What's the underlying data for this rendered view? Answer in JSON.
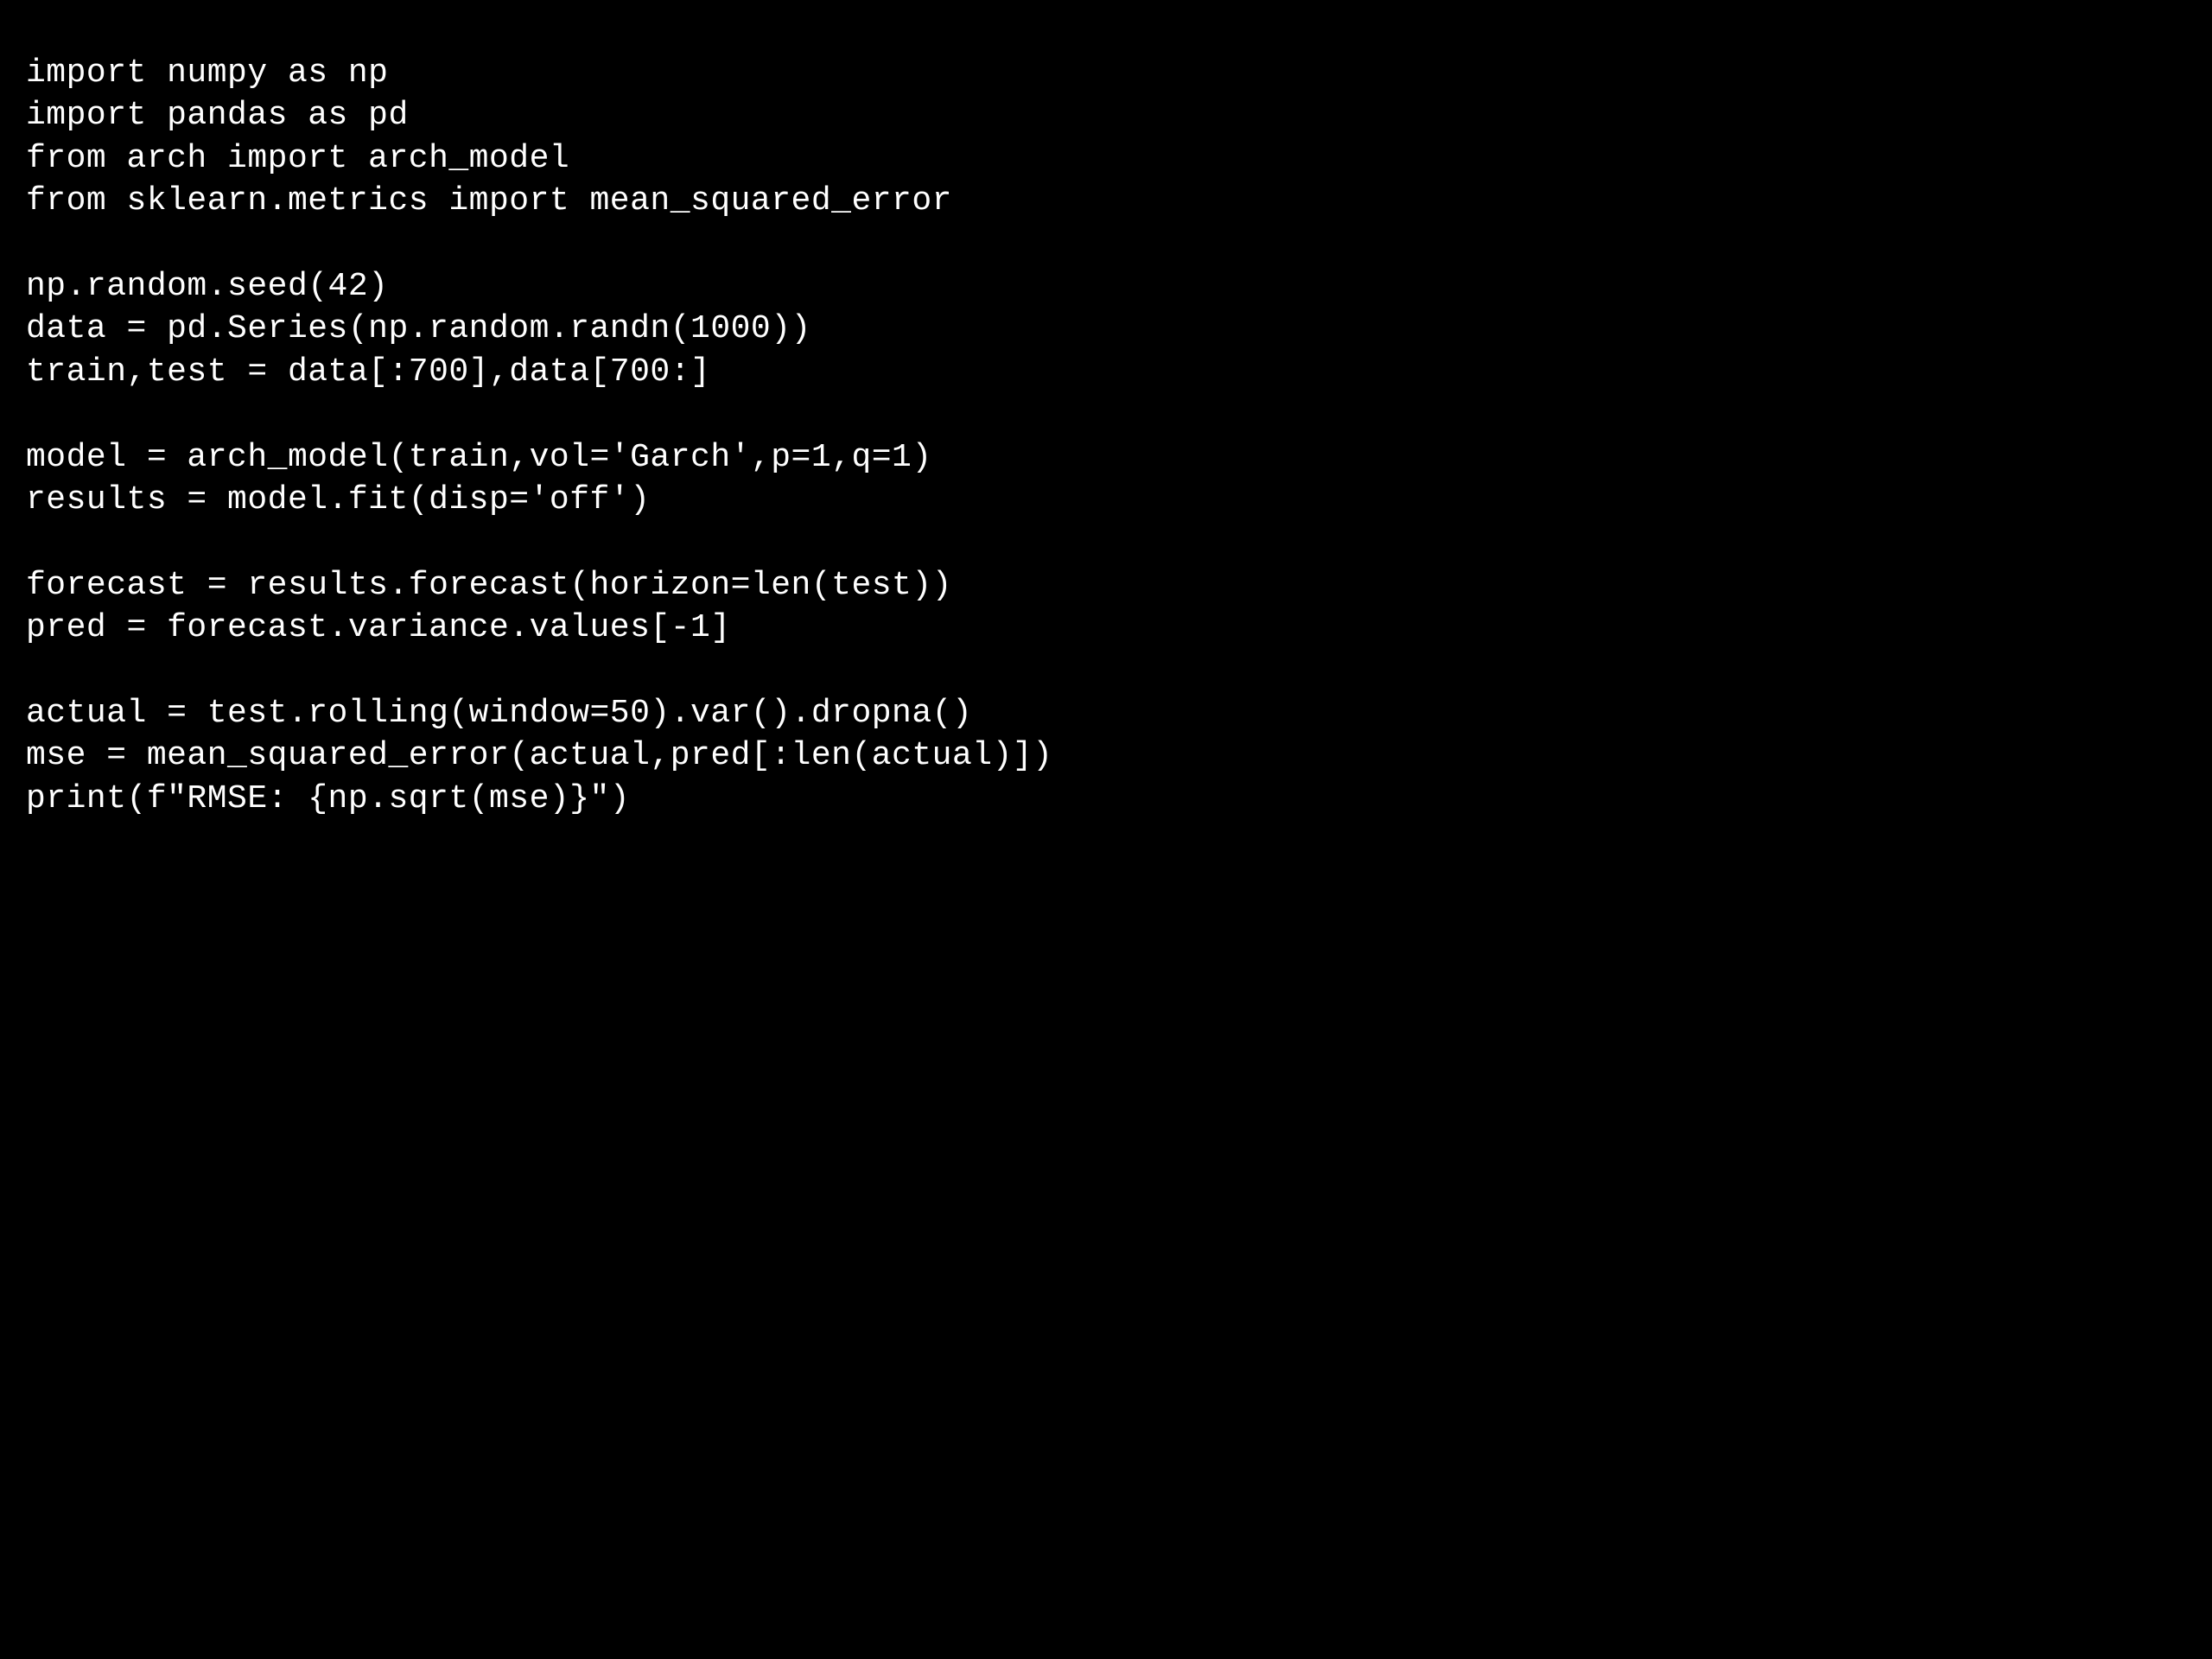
{
  "code": {
    "line1": "import numpy as np",
    "line2": "import pandas as pd",
    "line3": "from arch import arch_model",
    "line4": "from sklearn.metrics import mean_squared_error",
    "line5": "",
    "line6": "np.random.seed(42)",
    "line7": "data = pd.Series(np.random.randn(1000))",
    "line8": "train,test = data[:700],data[700:]",
    "line9": "",
    "line10": "model = arch_model(train,vol='Garch',p=1,q=1)",
    "line11": "results = model.fit(disp='off')",
    "line12": "",
    "line13": "forecast = results.forecast(horizon=len(test))",
    "line14": "pred = forecast.variance.values[-1]",
    "line15": "",
    "line16": "actual = test.rolling(window=50).var().dropna()",
    "line17": "mse = mean_squared_error(actual,pred[:len(actual)])",
    "line18": "print(f\"RMSE: {np.sqrt(mse)}\")"
  }
}
